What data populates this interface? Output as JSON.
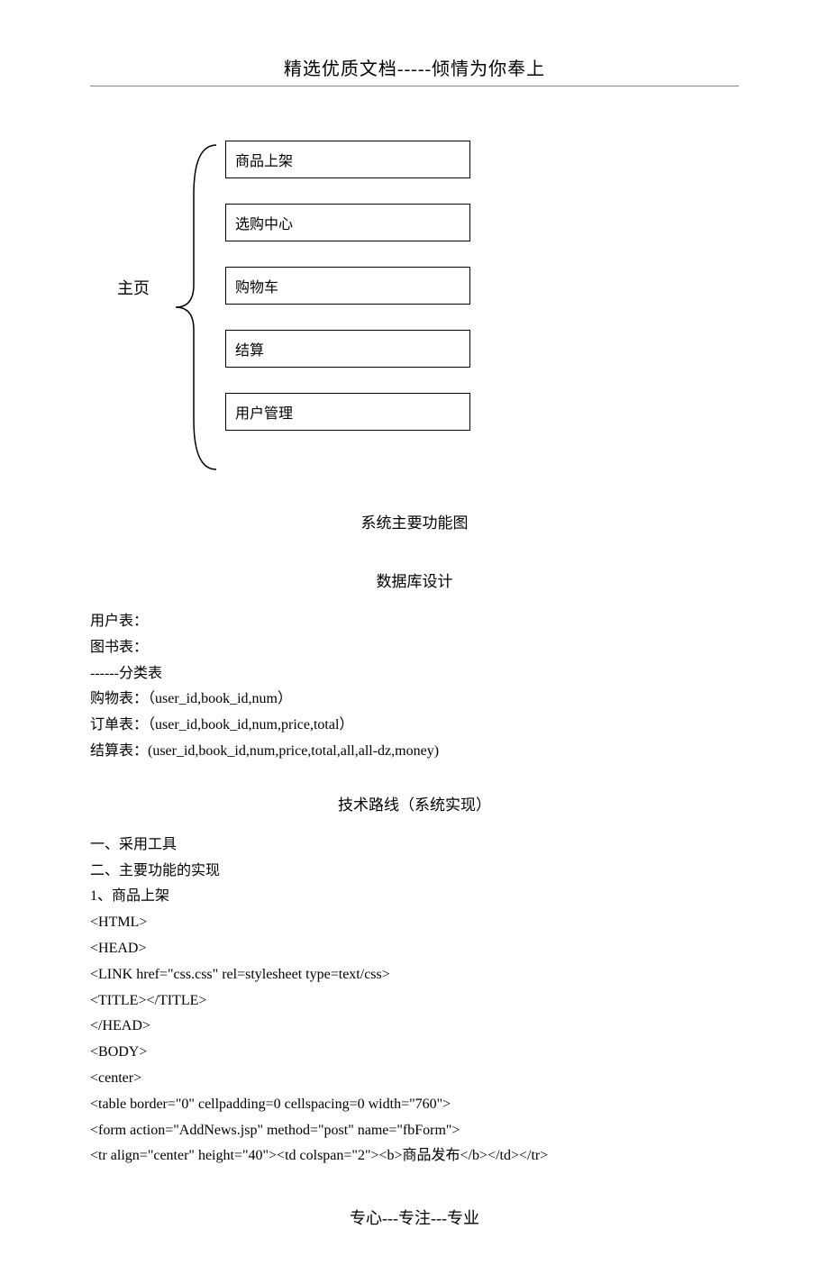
{
  "header": {
    "title": "精选优质文档-----倾情为你奉上"
  },
  "diagram": {
    "root_label": "主页",
    "boxes": [
      {
        "label": "商品上架"
      },
      {
        "label": "选购中心"
      },
      {
        "label": "购物车"
      },
      {
        "label": "结算"
      },
      {
        "label": "用户管理"
      }
    ],
    "caption": "系统主要功能图"
  },
  "db_section": {
    "title": "数据库设计",
    "lines": [
      "用户表：",
      "图书表：",
      "------分类表",
      "购物表：（user_id,book_id,num）",
      "订单表：（user_id,book_id,num,price,total）",
      "结算表：(user_id,book_id,num,price,total,all,all-dz,money)"
    ]
  },
  "tech_section": {
    "title": "技术路线（系统实现）",
    "lines": [
      "一、采用工具",
      "二、主要功能的实现",
      "1、商品上架",
      "<HTML>",
      "<HEAD>",
      "<LINK href=\"css.css\" rel=stylesheet type=text/css>",
      "<TITLE></TITLE>",
      "</HEAD>",
      "<BODY>",
      "<center>",
      "<table border=\"0\" cellpadding=0 cellspacing=0 width=\"760\">",
      "<form action=\"AddNews.jsp\" method=\"post\" name=\"fbForm\">",
      "<tr align=\"center\" height=\"40\"><td colspan=\"2\"><b>商品发布</b></td></tr>"
    ]
  },
  "footer": {
    "text": "专心---专注---专业"
  }
}
